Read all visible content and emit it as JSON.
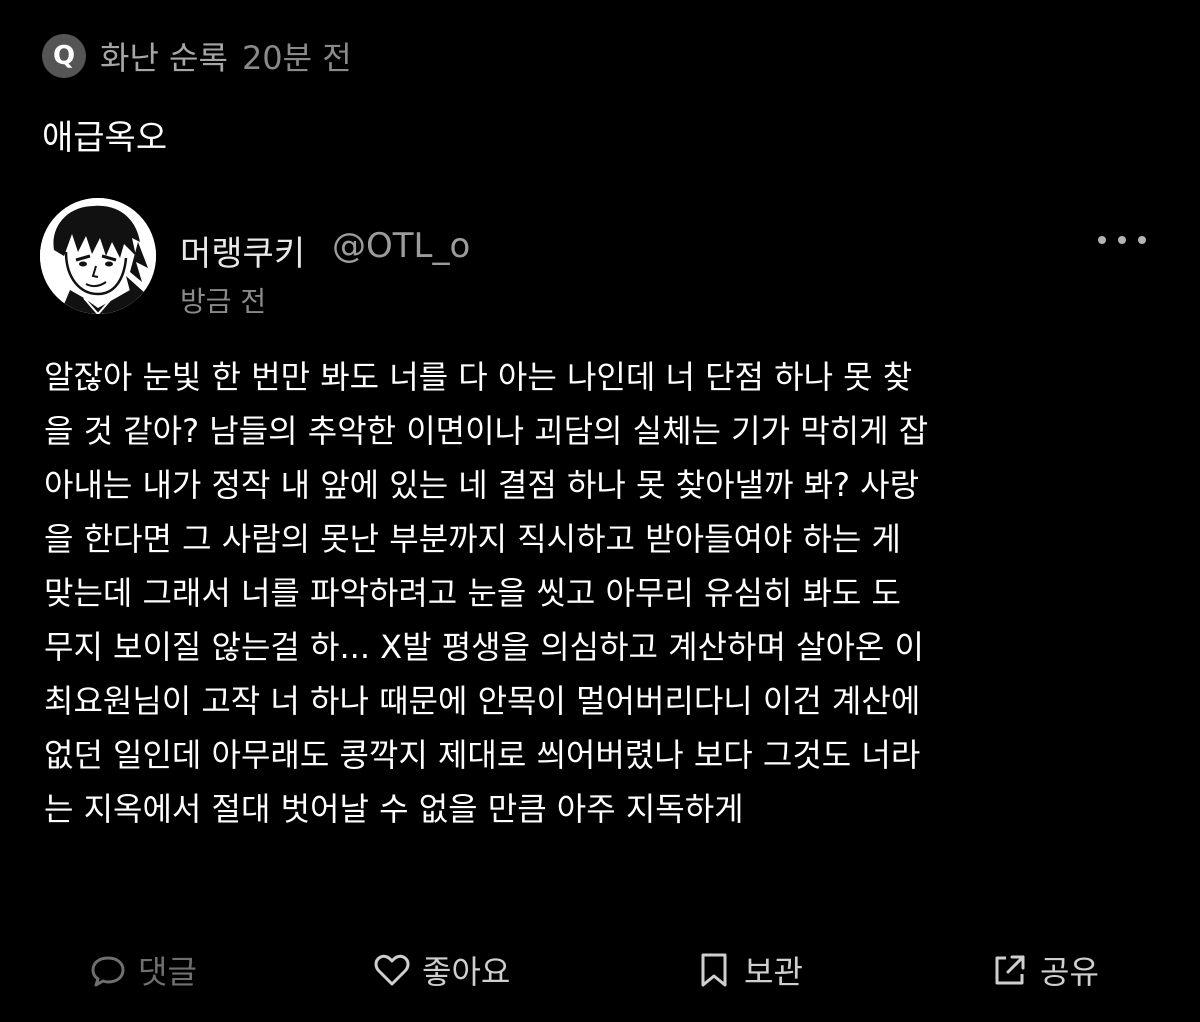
{
  "context": {
    "badge_letter": "Q",
    "community_name": "화난 순록",
    "time": "20분 전"
  },
  "post_title": "애급옥오",
  "author": {
    "name": "머랭쿠키",
    "handle": "@OTL_o",
    "time": "방금 전",
    "avatar": "manga-character-avatar"
  },
  "body_lines": [
    "알잖아 눈빛 한 번만 봐도 너를 다 아는 나인데 너 단점 하나 못 찾",
    "을 것 같아? 남들의 추악한 이면이나 괴담의 실체는 기가 막히게 잡",
    "아내는 내가 정작 내 앞에 있는 네 결점 하나 못 찾아낼까 봐? 사랑",
    "을 한다면 그 사람의 못난 부분까지 직시하고 받아들여야 하는 게",
    "맞는데 그래서 너를 파악하려고 눈을 씻고 아무리 유심히 봐도 도",
    "무지 보이질 않는걸 하... X발 평생을 의심하고 계산하며 살아온 이",
    "최요원님이 고작 너 하나 때문에 안목이 멀어버리다니 이건 계산에",
    "없던 일인데 아무래도 콩깍지 제대로 씌어버렸나 보다 그것도 너라",
    "는 지옥에서 절대 벗어날 수 없을 만큼 아주 지독하게"
  ],
  "actions": {
    "comment": {
      "label": "댓글",
      "icon": "speech-bubble-icon"
    },
    "like": {
      "label": "좋아요",
      "icon": "heart-icon"
    },
    "save": {
      "label": "보관",
      "icon": "bookmark-icon"
    },
    "share": {
      "label": "공유",
      "icon": "share-icon"
    }
  },
  "colors": {
    "background": "#000000",
    "text_primary": "#ffffff",
    "text_secondary": "#8a8a8a",
    "comment_disabled": "#6f6f6f"
  }
}
